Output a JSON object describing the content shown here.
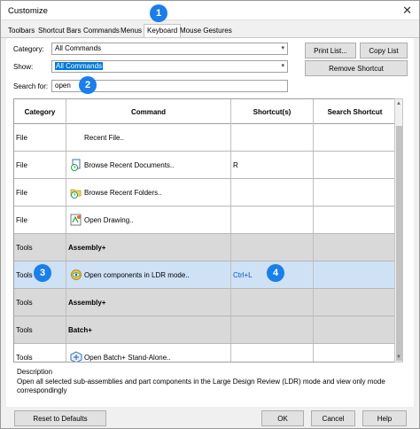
{
  "window": {
    "title": "Customize"
  },
  "tabs": [
    "Toolbars",
    "Shortcut Bars",
    "Commands",
    "Menus",
    "Keyboard",
    "Mouse Gestures"
  ],
  "active_tab": "Keyboard",
  "filters": {
    "category_label": "Category:",
    "category_value": "All Commands",
    "show_label": "Show:",
    "show_value": "All Commands",
    "search_label": "Search for:",
    "search_value": "open"
  },
  "buttons": {
    "print_list": "Print List...",
    "copy_list": "Copy List",
    "remove_shortcut": "Remove Shortcut",
    "reset_defaults": "Reset to Defaults",
    "ok": "OK",
    "cancel": "Cancel",
    "help": "Help"
  },
  "table": {
    "columns": [
      "Category",
      "Command",
      "Shortcut(s)",
      "Search Shortcut"
    ],
    "rows": [
      {
        "category": "File",
        "command": "Recent File..",
        "shortcut": "",
        "search": "",
        "icon": "none"
      },
      {
        "category": "File",
        "command": "Browse Recent Documents..",
        "shortcut": "R",
        "search": "",
        "icon": "recent-documents-icon"
      },
      {
        "category": "File",
        "command": "Browse Recent Folders..",
        "shortcut": "",
        "search": "",
        "icon": "recent-folders-icon"
      },
      {
        "category": "File",
        "command": "Open Drawing..",
        "shortcut": "",
        "search": "",
        "icon": "open-drawing-icon"
      },
      {
        "category": "Tools",
        "command": "Assembly+",
        "shortcut": "",
        "search": "",
        "icon": "none",
        "group": true
      },
      {
        "category": "Tools",
        "command": "Open components in LDR mode..",
        "shortcut": "Ctrl+L",
        "search": "",
        "icon": "ldr-mode-icon",
        "selected": true
      },
      {
        "category": "Tools",
        "command": "Assembly+",
        "shortcut": "",
        "search": "",
        "icon": "none",
        "group": true
      },
      {
        "category": "Tools",
        "command": "Batch+",
        "shortcut": "",
        "search": "",
        "icon": "none",
        "group": true
      },
      {
        "category": "Tools",
        "command": "Open Batch+ Stand-Alone..",
        "shortcut": "",
        "search": "",
        "icon": "batch-icon"
      }
    ]
  },
  "description": {
    "label": "Description",
    "text": "Open all selected sub-assemblies and part components in the Large Design Review (LDR) mode and view only mode correspondingly"
  },
  "callouts": [
    "1",
    "2",
    "3",
    "4"
  ],
  "colors": {
    "accent": "#1a7fe8",
    "selected_row": "#cfe1f5",
    "group_row": "#d9d9d9",
    "shortcut_text": "#0055cc"
  }
}
